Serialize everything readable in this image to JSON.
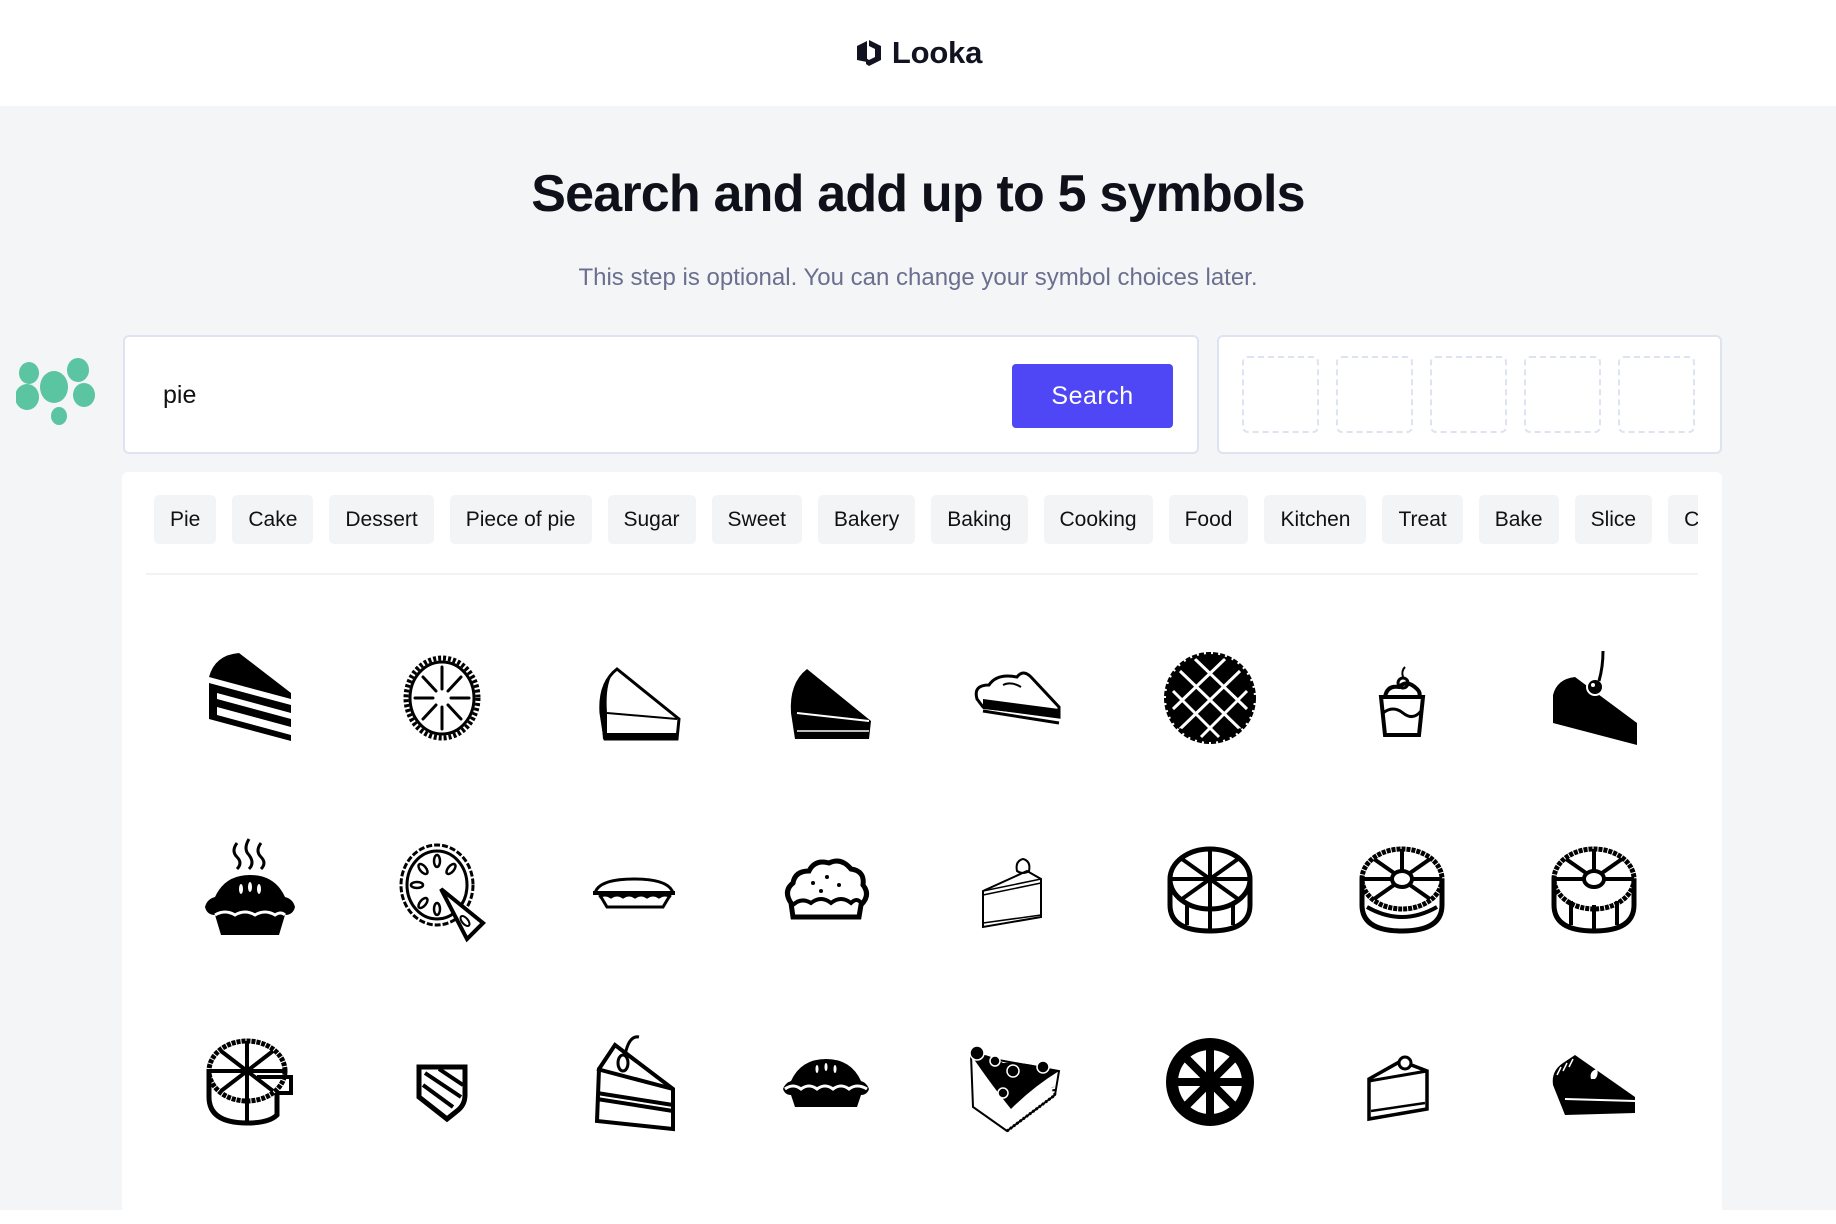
{
  "header": {
    "brand_name": "Looka",
    "logo_icon": "looka-hexagon-logo-icon"
  },
  "main": {
    "title": "Search and add up to 5 symbols",
    "subtitle": "This step is optional. You can change your symbol choices later."
  },
  "search": {
    "value": "pie",
    "placeholder": "",
    "button_label": "Search",
    "button_color": "#4f46f5"
  },
  "decoration": {
    "icon": "green-dots-blob-icon",
    "color": "#5bc4a0"
  },
  "selected_slots": {
    "max": 5,
    "filled": 0
  },
  "tags": [
    "Pie",
    "Cake",
    "Dessert",
    "Piece of pie",
    "Sugar",
    "Sweet",
    "Bakery",
    "Baking",
    "Cooking",
    "Food",
    "Kitchen",
    "Treat",
    "Bake",
    "Slice",
    "Cr"
  ],
  "symbols": [
    {
      "name": "layered-cake-slice-icon"
    },
    {
      "name": "round-pie-top-icon"
    },
    {
      "name": "outline-pie-slice-icon"
    },
    {
      "name": "filled-pie-slice-icon"
    },
    {
      "name": "cream-pie-slice-icon"
    },
    {
      "name": "lattice-pie-icon"
    },
    {
      "name": "cup-dessert-cherry-icon"
    },
    {
      "name": "cake-slice-cherry-icon"
    },
    {
      "name": "steaming-pie-icon"
    },
    {
      "name": "pie-with-slice-cut-icon"
    },
    {
      "name": "flat-pie-dish-icon"
    },
    {
      "name": "crumble-pie-icon"
    },
    {
      "name": "cream-cake-slice-outline-icon"
    },
    {
      "name": "cake-wheel-icon"
    },
    {
      "name": "decorated-cake-icon"
    },
    {
      "name": "tart-cake-icon"
    },
    {
      "name": "cake-missing-slice-icon"
    },
    {
      "name": "small-cake-slice-icon"
    },
    {
      "name": "layer-cake-cherry-icon"
    },
    {
      "name": "covered-pie-icon"
    },
    {
      "name": "blueberry-cheesecake-slice-icon"
    },
    {
      "name": "solid-pie-wheel-icon"
    },
    {
      "name": "cake-slice-cherry-outline-icon"
    },
    {
      "name": "pumpkin-pie-slice-icon"
    }
  ]
}
